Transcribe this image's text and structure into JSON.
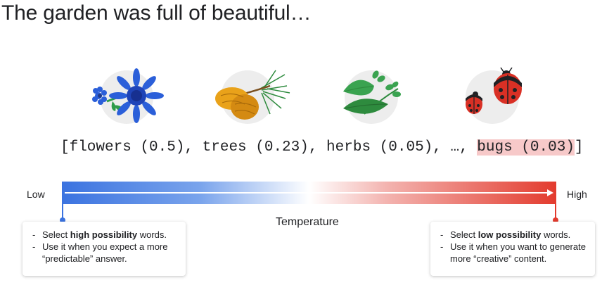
{
  "title": "The garden was full of beautiful…",
  "pictures": [
    "flowers-icon",
    "trees-icon",
    "herbs-icon",
    "bugs-icon"
  ],
  "words_line": {
    "prefix": "[flowers (0.5), trees (0.23), herbs (0.05), …, ",
    "highlight": "bugs (0.03)",
    "suffix": "]"
  },
  "scale": {
    "low_label": "Low",
    "high_label": "High",
    "axis_label": "Temperature",
    "colors": {
      "low": "#3b73e0",
      "high": "#e33b2e"
    }
  },
  "low_card": {
    "line1_pre": "Select ",
    "line1_bold": "high possibility",
    "line1_post": " words.",
    "line2": "Use it when you expect a more “predictable” answer."
  },
  "high_card": {
    "line1_pre": "Select ",
    "line1_bold": "low possibility",
    "line1_post": " words.",
    "line2": "Use it when you want to generate more “creative” content."
  }
}
